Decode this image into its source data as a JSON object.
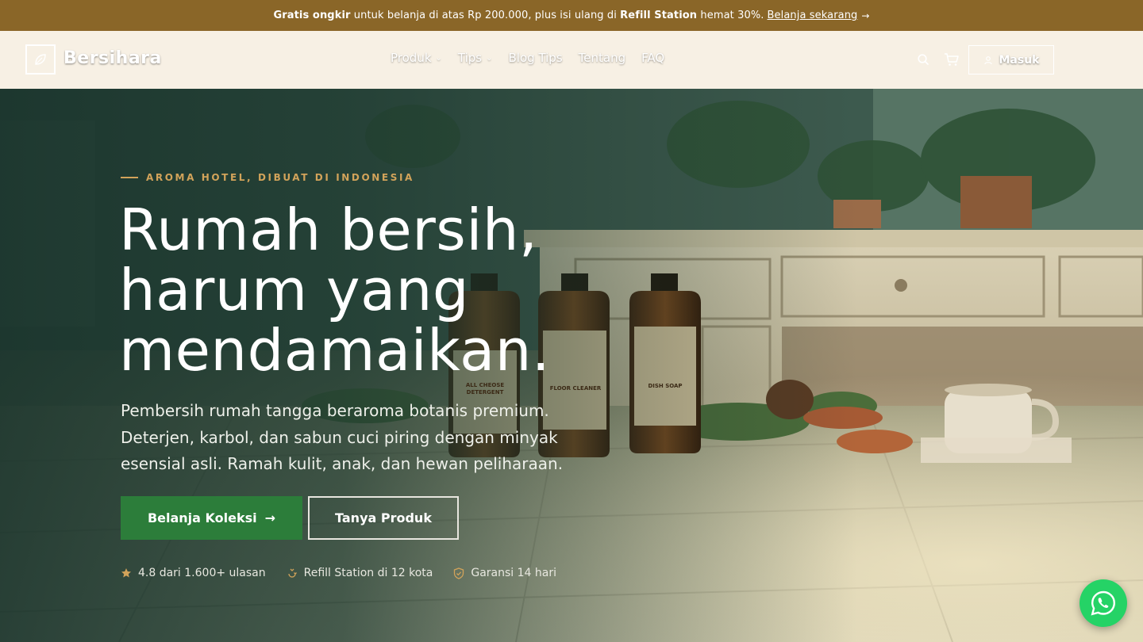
{
  "announcement": {
    "bold1": "Gratis ongkir",
    "text1": " untuk belanja di atas Rp 200.000, plus isi ulang di ",
    "bold2": "Refill Station",
    "text2": " hemat 30%.",
    "link": "Belanja sekarang",
    "link_icon": "arrow-right-icon"
  },
  "header": {
    "logo_icon": "leaf-icon",
    "brand": "Bersihara",
    "nav": [
      {
        "label": "Produk",
        "has_dropdown": true
      },
      {
        "label": "Tips",
        "has_dropdown": true
      },
      {
        "label": "Blog Tips",
        "has_dropdown": false
      },
      {
        "label": "Tentang",
        "has_dropdown": false
      },
      {
        "label": "FAQ",
        "has_dropdown": false
      }
    ],
    "search_icon": "search-icon",
    "cart_icon": "cart-icon",
    "login_label": "Masuk",
    "login_icon": "user-icon"
  },
  "hero": {
    "eyebrow": "AROMA HOTEL, DIBUAT DI INDONESIA",
    "headline_lines": [
      "Rumah bersih,",
      "harum yang",
      "mendamaikan."
    ],
    "subhead": "Pembersih rumah tangga beraroma botanis premium. Deterjen, karbol, dan sabun cuci piring dengan minyak esensial asli. Ramah kulit, anak, dan hewan peliharaan.",
    "primary_cta": "Belanja Koleksi",
    "secondary_cta": "Tanya Produk",
    "bottle_labels": [
      "ALL CHEOSE DETERGENT",
      "FLOOR CLEANER",
      "DISH SOAP"
    ],
    "trust": [
      {
        "icon": "star-icon",
        "text": "4.8 dari 1.600+ ulasan"
      },
      {
        "icon": "refill-icon",
        "text": "Refill Station di 12 kota"
      },
      {
        "icon": "shield-icon",
        "text": "Garansi 14 hari"
      }
    ]
  },
  "whatsapp_icon": "whatsapp-icon",
  "colors": {
    "announcement_bg": "#8a6628",
    "header_bg": "#f7f0e4",
    "primary": "#2c7d3a",
    "accent": "#d2a35a",
    "whatsapp": "#25d366"
  }
}
